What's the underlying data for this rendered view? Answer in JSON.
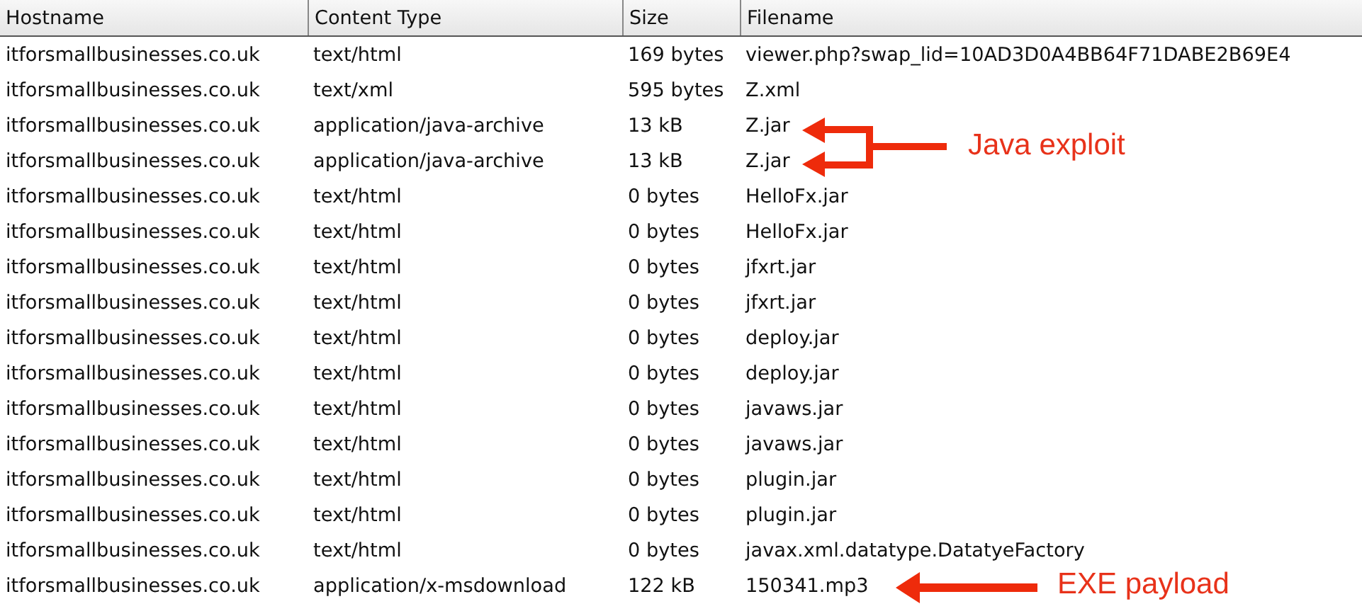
{
  "table": {
    "columns": [
      "Hostname",
      "Content Type",
      "Size",
      "Filename"
    ],
    "rows": [
      [
        "itforsmallbusinesses.co.uk",
        "text/html",
        "169 bytes",
        "viewer.php?swap_lid=10AD3D0A4BB64F71DABE2B69E4"
      ],
      [
        "itforsmallbusinesses.co.uk",
        "text/xml",
        "595 bytes",
        "Z.xml"
      ],
      [
        "itforsmallbusinesses.co.uk",
        "application/java-archive",
        "13 kB",
        "Z.jar"
      ],
      [
        "itforsmallbusinesses.co.uk",
        "application/java-archive",
        "13 kB",
        "Z.jar"
      ],
      [
        "itforsmallbusinesses.co.uk",
        "text/html",
        "0 bytes",
        "HelloFx.jar"
      ],
      [
        "itforsmallbusinesses.co.uk",
        "text/html",
        "0 bytes",
        "HelloFx.jar"
      ],
      [
        "itforsmallbusinesses.co.uk",
        "text/html",
        "0 bytes",
        "jfxrt.jar"
      ],
      [
        "itforsmallbusinesses.co.uk",
        "text/html",
        "0 bytes",
        "jfxrt.jar"
      ],
      [
        "itforsmallbusinesses.co.uk",
        "text/html",
        "0 bytes",
        "deploy.jar"
      ],
      [
        "itforsmallbusinesses.co.uk",
        "text/html",
        "0 bytes",
        "deploy.jar"
      ],
      [
        "itforsmallbusinesses.co.uk",
        "text/html",
        "0 bytes",
        "javaws.jar"
      ],
      [
        "itforsmallbusinesses.co.uk",
        "text/html",
        "0 bytes",
        "javaws.jar"
      ],
      [
        "itforsmallbusinesses.co.uk",
        "text/html",
        "0 bytes",
        "plugin.jar"
      ],
      [
        "itforsmallbusinesses.co.uk",
        "text/html",
        "0 bytes",
        "plugin.jar"
      ],
      [
        "itforsmallbusinesses.co.uk",
        "text/html",
        "0 bytes",
        "javax.xml.datatype.DatatyeFactory"
      ],
      [
        "itforsmallbusinesses.co.uk",
        "application/x-msdownload",
        "122 kB",
        "150341.mp3"
      ]
    ]
  },
  "annotations": [
    {
      "text": "Java exploit"
    },
    {
      "text": "EXE payload"
    }
  ]
}
